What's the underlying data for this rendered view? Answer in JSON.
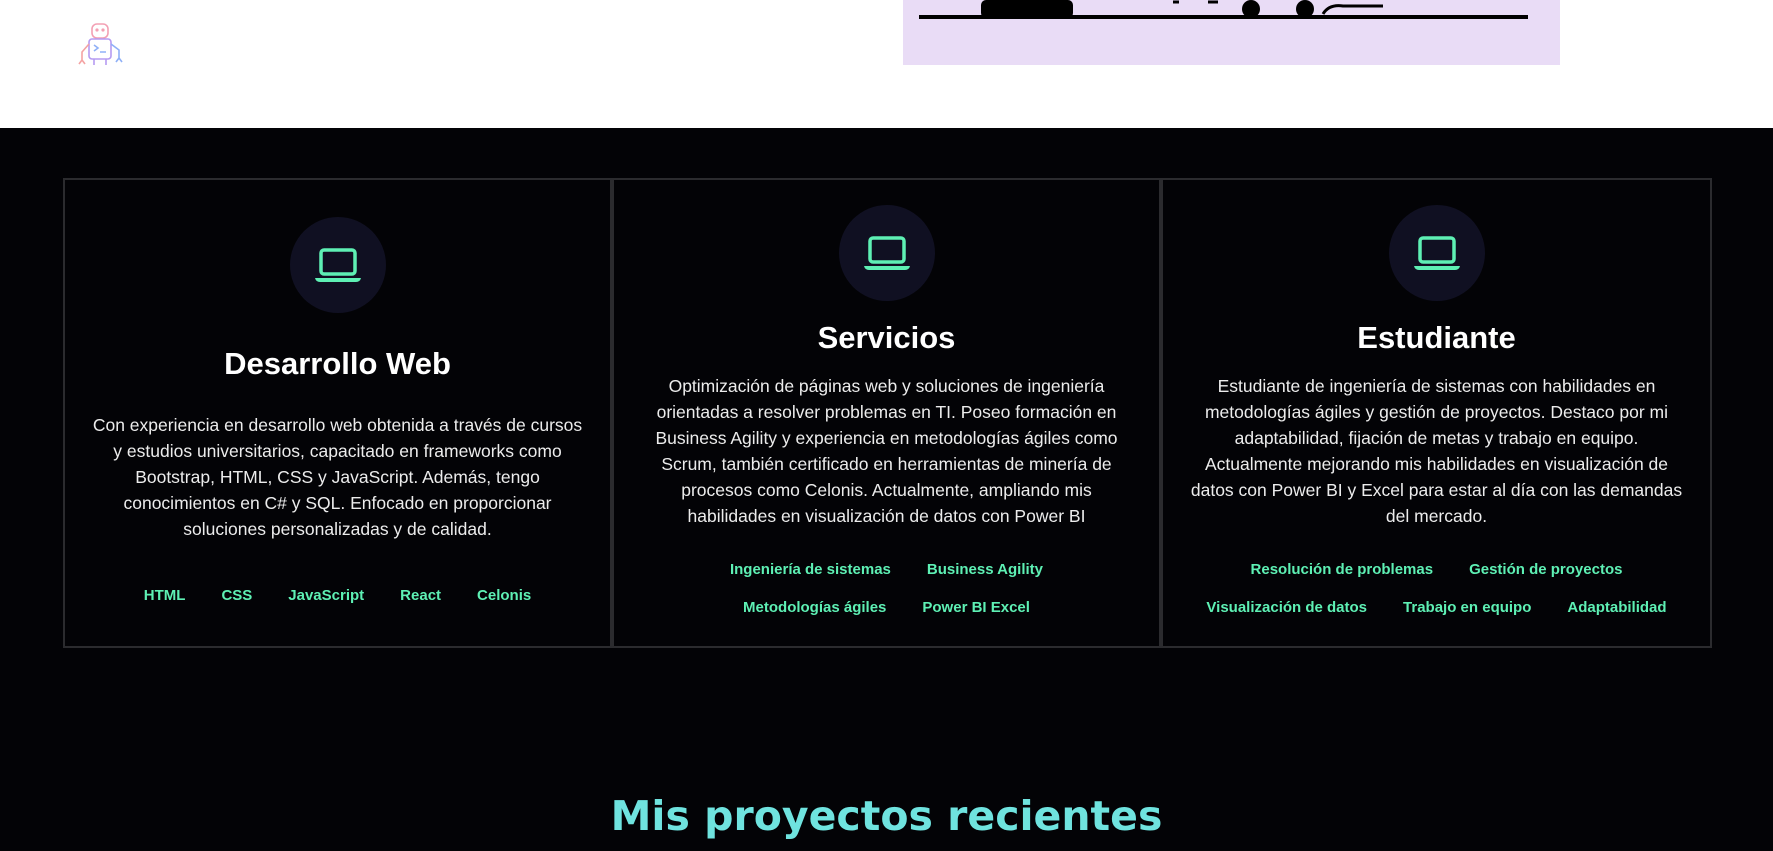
{
  "cards": [
    {
      "title": "Desarrollo Web",
      "description": "Con experiencia en desarrollo web obtenida a través de cursos y estudios universitarios, capacitado en frameworks como Bootstrap, HTML, CSS y JavaScript. Además, tengo conocimientos en C# y SQL. Enfocado en proporcionar soluciones personalizadas y de calidad.",
      "tags": [
        "HTML",
        "CSS",
        "JavaScript",
        "React",
        "Celonis"
      ],
      "icon": "laptop-icon"
    },
    {
      "title": "Servicios",
      "description": "Optimización de páginas web y soluciones de ingeniería orientadas a resolver problemas en TI. Poseo formación en Business Agility y experiencia en metodologías ágiles como Scrum, también certificado en herramientas de minería de procesos como Celonis. Actualmente, ampliando mis habilidades en visualización de datos con Power BI",
      "tags": [
        "Ingeniería de sistemas",
        "Business Agility",
        "Metodologías ágiles",
        "Power BI Excel"
      ],
      "icon": "laptop-icon"
    },
    {
      "title": "Estudiante",
      "description": "Estudiante de ingeniería de sistemas con habilidades en metodologías ágiles y gestión de proyectos. Destaco por mi adaptabilidad, fijación de metas y trabajo en equipo. Actualmente mejorando mis habilidades en visualización de datos con Power BI y Excel para estar al día con las demandas del mercado.",
      "tags": [
        "Resolución de problemas",
        "Gestión de proyectos",
        "Visualización de datos",
        "Trabajo en equipo",
        "Adaptabilidad"
      ],
      "icon": "laptop-icon"
    }
  ],
  "section_title": "Mis proyectos recientes",
  "colors": {
    "accent": "#5ef0b4",
    "heading": "#6fe3df",
    "background": "#030306",
    "icon_circle": "#101022"
  }
}
